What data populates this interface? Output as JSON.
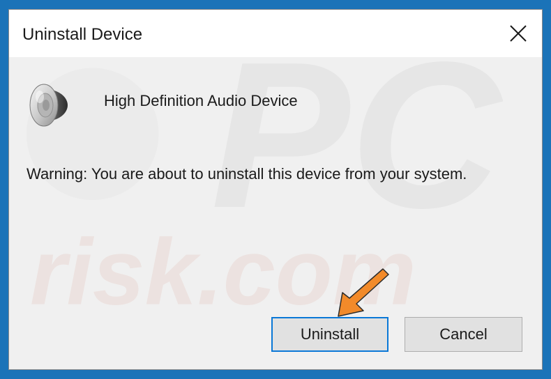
{
  "dialog": {
    "title": "Uninstall Device",
    "close_icon": "close-icon"
  },
  "device": {
    "icon": "speaker-icon",
    "name": "High Definition Audio Device"
  },
  "warning_text": "Warning: You are about to uninstall this device from your system.",
  "buttons": {
    "uninstall_label": "Uninstall",
    "cancel_label": "Cancel"
  },
  "annotation": {
    "icon": "arrow-pointer-icon",
    "color": "#f28a2a"
  },
  "watermark": {
    "text_primary": "PC",
    "text_secondary": "risk.com"
  },
  "colors": {
    "desktop_background": "#1b73b8",
    "dialog_background": "#f0f0f0",
    "titlebar_background": "#ffffff",
    "default_button_border": "#0a78d7",
    "button_background": "#e1e1e1"
  }
}
